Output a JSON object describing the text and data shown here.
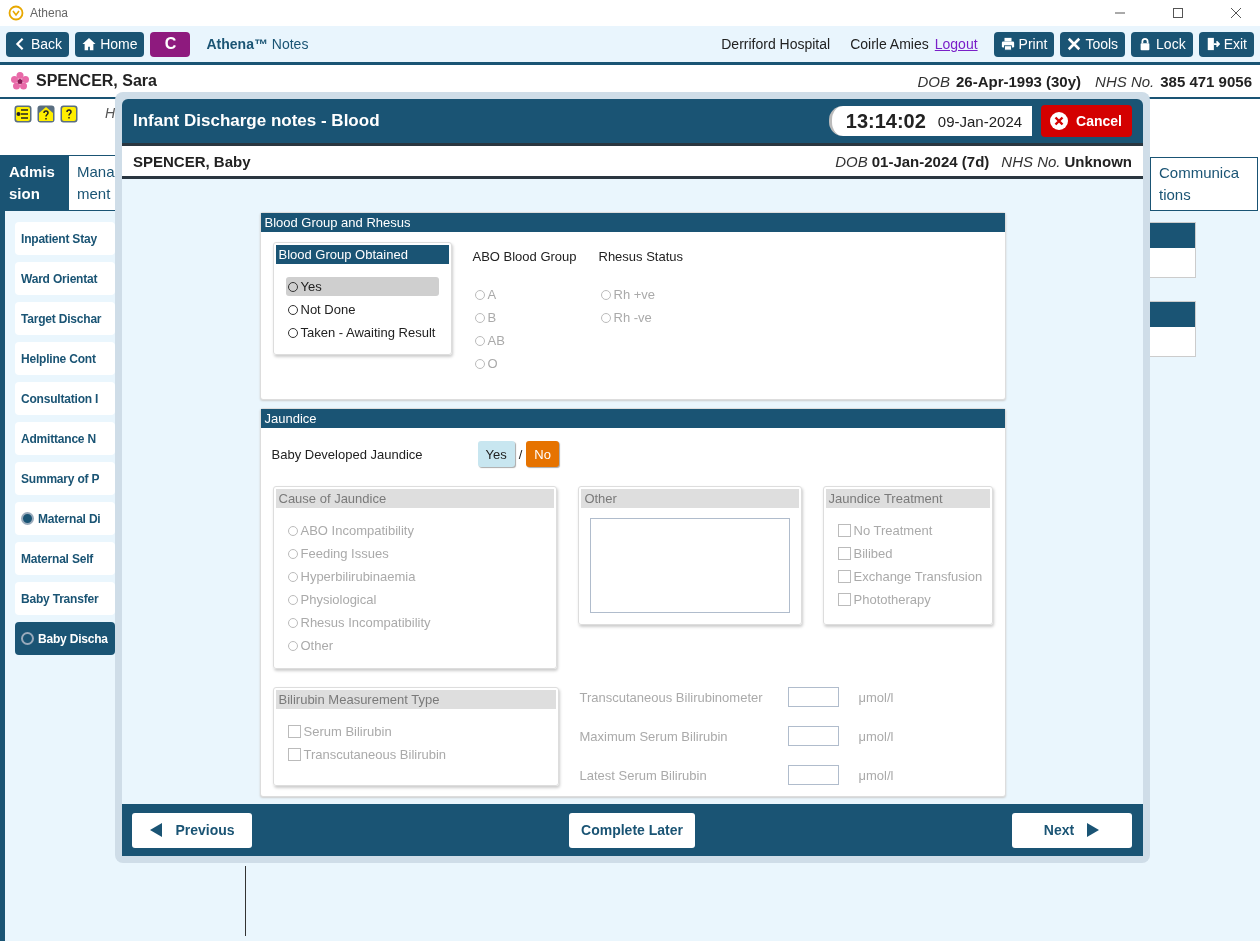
{
  "window": {
    "title": "Athena"
  },
  "toolbar": {
    "left_buttons": [
      {
        "kind": "back",
        "label": "Back"
      },
      {
        "kind": "home",
        "label": "Home"
      }
    ],
    "app_badge": "C",
    "app_name": "Athena™",
    "app_section": "Notes",
    "hospital": "Derriford Hospital",
    "user": "Coirle Amies",
    "logout": "Logout",
    "right_buttons": [
      {
        "kind": "print",
        "label": "Print"
      },
      {
        "kind": "tools",
        "label": "Tools"
      },
      {
        "kind": "lock",
        "label": "Lock"
      },
      {
        "kind": "exit",
        "label": "Exit"
      }
    ]
  },
  "patient": {
    "name": "SPENCER, Sara",
    "dob_label": "DOB",
    "dob": "26-Apr-1993 (30y)",
    "nhs_label": "NHS No.",
    "nhs": "385 471 9056"
  },
  "header_note": "H",
  "tabs": [
    {
      "lines": [
        "Admis",
        "sion"
      ],
      "selected": true
    },
    {
      "lines": [
        "Mana",
        "ment"
      ],
      "selected": false
    },
    {
      "lines": [
        "Communica",
        "tions"
      ],
      "selected": false
    }
  ],
  "sidebar": {
    "items": [
      {
        "label": "Inpatient Stay",
        "selected": false
      },
      {
        "label": "Ward Orientat",
        "selected": false
      },
      {
        "label": "Target Dischar",
        "selected": false
      },
      {
        "label": "Helpline Cont",
        "selected": false
      },
      {
        "label": "Consultation I",
        "selected": false
      },
      {
        "label": "Admittance N",
        "selected": false
      },
      {
        "label": "Summary of P",
        "selected": false
      },
      {
        "label": "Maternal Di",
        "selected": false,
        "checked": true
      },
      {
        "label": "Maternal Self",
        "selected": false
      },
      {
        "label": "Baby Transfer",
        "selected": false
      },
      {
        "label": "Baby Discha",
        "selected": true,
        "checked": false
      }
    ]
  },
  "dialog": {
    "title": "Infant Discharge notes - Blood",
    "time": "13:14:02",
    "date": "09-Jan-2024",
    "cancel": "Cancel",
    "patient": {
      "name": "SPENCER, Baby",
      "dob_label": "DOB",
      "dob": "01-Jan-2024 (7d)",
      "nhs_label": "NHS No.",
      "nhs": "Unknown"
    },
    "blood": {
      "title": "Blood Group and Rhesus",
      "obtained": {
        "title": "Blood Group Obtained",
        "options": [
          {
            "label": "Yes",
            "selected": false,
            "focused": true
          },
          {
            "label": "Not Done",
            "selected": false,
            "focused": false
          },
          {
            "label": "Taken - Awaiting Result",
            "selected": false,
            "focused": false
          }
        ]
      },
      "abo": {
        "title": "ABO Blood Group",
        "disabled": true,
        "options": [
          {
            "label": "A",
            "selected": false
          },
          {
            "label": "B",
            "selected": false
          },
          {
            "label": "AB",
            "selected": false
          },
          {
            "label": "O",
            "selected": false
          }
        ]
      },
      "rhesus": {
        "title": "Rhesus Status",
        "disabled": true,
        "options": [
          {
            "label": "Rh +ve",
            "selected": false
          },
          {
            "label": "Rh -ve",
            "selected": false
          }
        ]
      }
    },
    "jaundice": {
      "title": "Jaundice",
      "question": "Baby Developed Jaundice",
      "answers": [
        {
          "label": "Yes",
          "selected": false
        },
        {
          "label": "No",
          "selected": true
        }
      ],
      "separator": "/",
      "cause": {
        "title": "Cause of Jaundice",
        "disabled": true,
        "options": [
          {
            "label": "ABO Incompatibility",
            "selected": false
          },
          {
            "label": "Feeding Issues",
            "selected": false
          },
          {
            "label": "Hyperbilirubinaemia",
            "selected": false
          },
          {
            "label": "Physiological",
            "selected": false
          },
          {
            "label": "Rhesus Incompatibility",
            "selected": false
          },
          {
            "label": "Other",
            "selected": false
          }
        ]
      },
      "other": {
        "title": "Other",
        "disabled": true
      },
      "treatment": {
        "title": "Jaundice Treatment",
        "disabled": true,
        "options": [
          {
            "label": "No Treatment",
            "checked": false
          },
          {
            "label": "Bilibed",
            "checked": false
          },
          {
            "label": "Exchange Transfusion",
            "checked": false
          },
          {
            "label": "Phototherapy",
            "checked": false
          }
        ]
      },
      "measurement_type": {
        "title": "Bilirubin Measurement Type",
        "disabled": true,
        "options": [
          {
            "label": "Serum Bilirubin",
            "checked": false
          },
          {
            "label": "Transcutaneous Bilirubin",
            "checked": false
          }
        ]
      },
      "measurements": [
        {
          "label": "Transcutaneous Bilirubinometer",
          "unit": "μmol/l",
          "disabled": true
        },
        {
          "label": "Maximum Serum Bilirubin",
          "unit": "μmol/l",
          "disabled": true
        },
        {
          "label": "Latest Serum Bilirubin",
          "unit": "μmol/l",
          "disabled": true
        }
      ]
    },
    "footer": {
      "previous": "Previous",
      "complete_later": "Complete Later",
      "next": "Next"
    }
  }
}
